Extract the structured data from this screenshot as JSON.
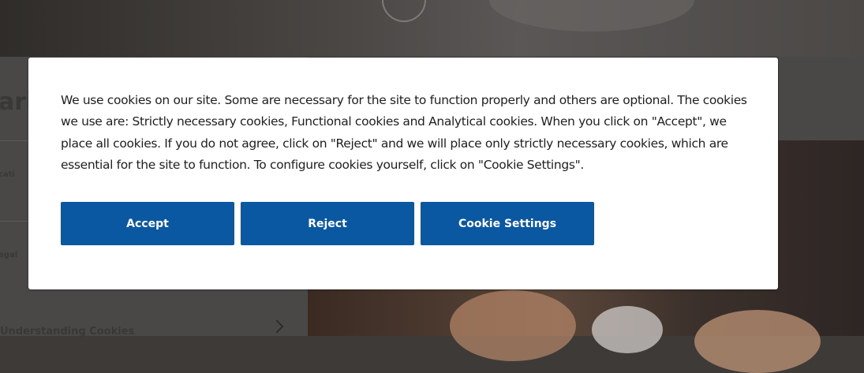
{
  "cookie_banner": {
    "message": "We use cookies on our site. Some are necessary for the site to function properly and others are optional. The cookies we use are: Strictly necessary cookies, Functional cookies and Analytical cookies. When you click on \"Accept\", we place all cookies. If you do not agree, click on \"Reject\" and we will place only strictly necessary cookies, which are essential for the site to function. To configure cookies yourself, click on \"Cookie Settings\".",
    "buttons": {
      "accept": "Accept",
      "reject": "Reject",
      "settings": "Cookie Settings"
    }
  },
  "colors": {
    "button_background": "#0a57a2",
    "button_text": "#ffffff",
    "overlay": "#3d3a38"
  }
}
